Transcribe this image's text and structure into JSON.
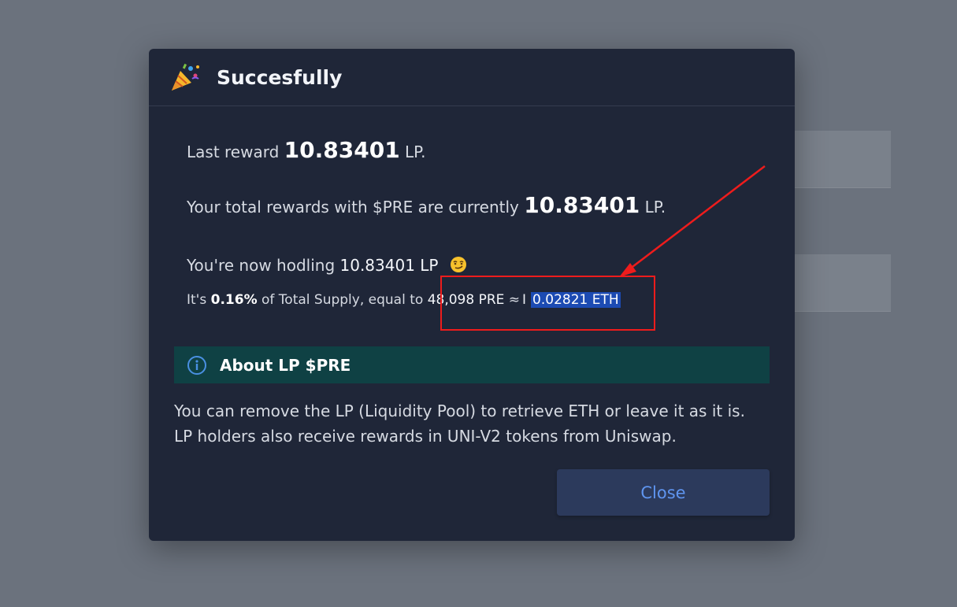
{
  "modal": {
    "title": "Succesfully",
    "last_reward": {
      "prefix": "Last reward ",
      "value": "10.83401",
      "unit": "LP."
    },
    "total_rewards": {
      "prefix": "Your total rewards with $PRE are currently ",
      "value": "10.83401",
      "unit": "LP."
    },
    "holding": {
      "text": "You're now hodling ",
      "value": "10.83401 LP",
      "emoji": "smirk-face-icon"
    },
    "supply": {
      "prefix": "It's ",
      "percent": "0.16%",
      "middle": " of Total Supply, equal to ",
      "pre_amount": "48,098 PRE",
      "separator": "≈",
      "eth_amount": "0.02821 ETH"
    },
    "about": {
      "title": "About LP $PRE",
      "line1": "You can remove the LP (Liquidity Pool) to retrieve ETH or leave it as it is.",
      "line2": "LP holders also receive rewards in UNI-V2 tokens from Uniswap."
    },
    "close_label": "Close"
  },
  "colors": {
    "backdrop": "#6b727d",
    "modal_bg": "#1f2638",
    "about_bg": "#0f4144",
    "button_bg": "#2c3a5c",
    "button_text": "#5f95f0",
    "selection": "#1c4bb3",
    "annotation": "#ee1c1c"
  }
}
